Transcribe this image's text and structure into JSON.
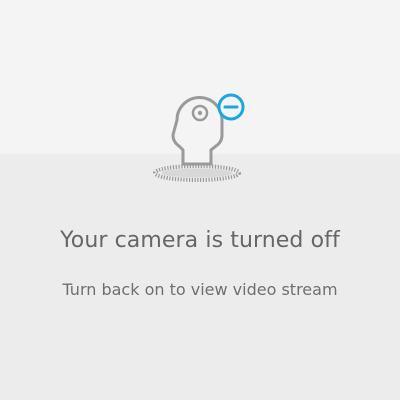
{
  "status": {
    "title": "Your camera is turned off",
    "subtitle": "Turn back on to view video stream",
    "icon": "camera-off-icon"
  },
  "colors": {
    "top_background": "#f4f4f4",
    "bottom_background": "#ececec",
    "icon_outline": "#9a9a9a",
    "off_badge": "#1aa6df",
    "text": "#666666"
  }
}
